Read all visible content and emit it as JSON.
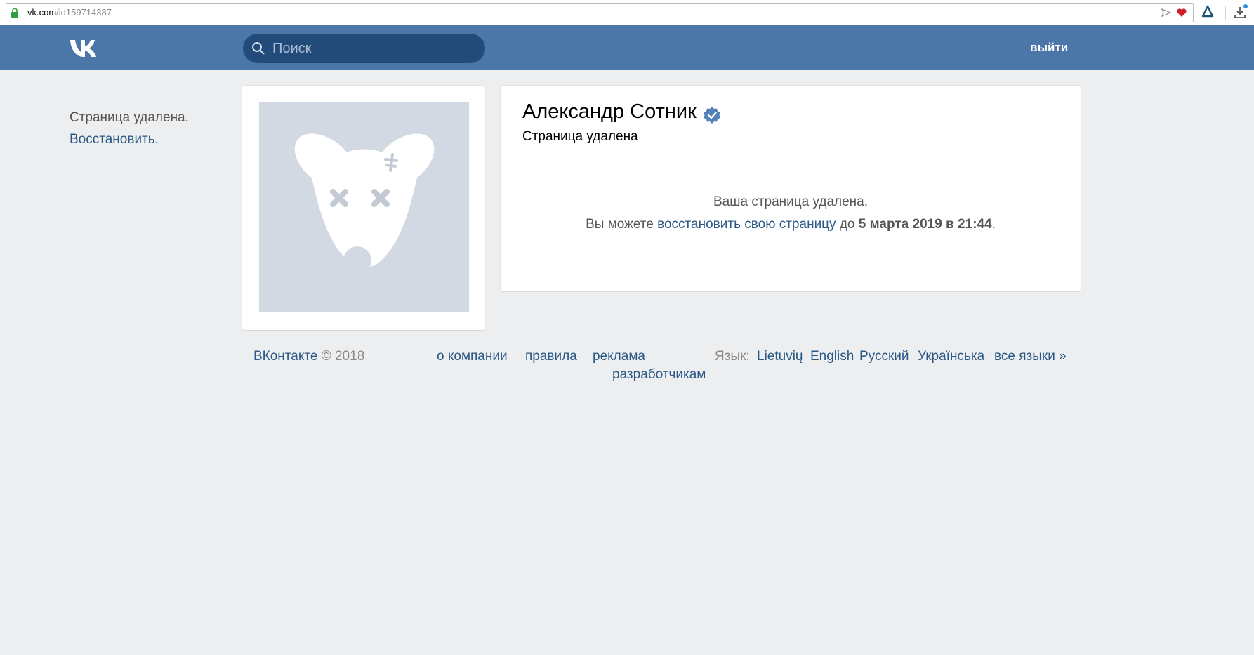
{
  "browser": {
    "url_host": "vk.com",
    "url_path": "/id159714387"
  },
  "header": {
    "search_placeholder": "Поиск",
    "logout_label": "выйти",
    "colors": {
      "header_bg": "#4a76a8",
      "search_bg": "#224b7a"
    }
  },
  "left": {
    "status_text": "Страница удалена.",
    "restore_label": "Восстановить."
  },
  "profile": {
    "name": "Александр Сотник",
    "status": "Страница удалена",
    "verified_icon": "verified-check-icon",
    "message_line1": "Ваша страница удалена.",
    "message_prefix": "Вы можете ",
    "restore_link": "восстановить свою страницу",
    "message_mid": " до ",
    "restore_date": "5 марта 2019 в 21:44",
    "message_end": "."
  },
  "footer": {
    "brand": "ВКонтакте",
    "copyright": " © 2018",
    "links": {
      "about": "о компании",
      "rules": "правила",
      "ads": "реклама",
      "developers": "разработчикам"
    },
    "language_label": "Язык:",
    "languages": {
      "lt": "Lietuvių",
      "en": "English",
      "ru": "Русский",
      "uk": "Українська",
      "all": "все языки »"
    }
  }
}
